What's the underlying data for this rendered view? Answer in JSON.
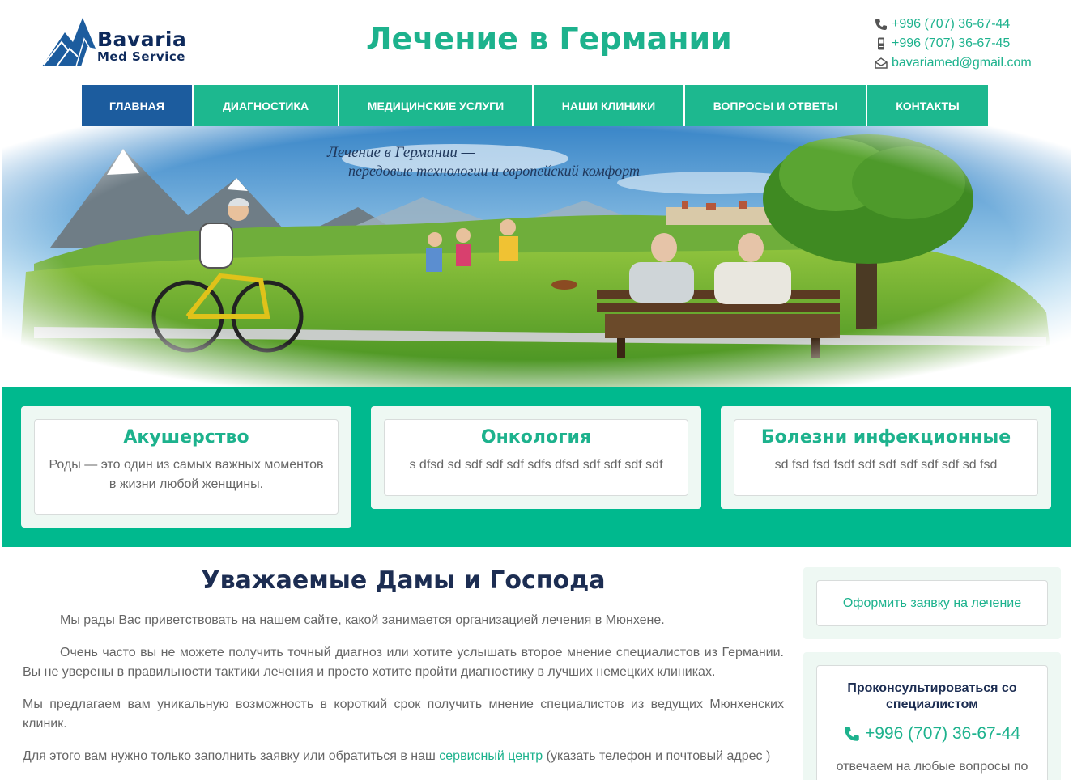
{
  "header": {
    "logo_name": "Bavaria",
    "logo_sub": "Med Service",
    "site_title": "Лечение в Германии",
    "phone1": "+996 (707) 36-67-44",
    "phone2": "+996 (707) 36-67-45",
    "email": "bavariamed@gmail.com"
  },
  "nav": {
    "items": [
      {
        "label": "ГЛАВНАЯ"
      },
      {
        "label": "ДИАГНОСТИКА"
      },
      {
        "label": "МЕДИЦИНСКИЕ УСЛУГИ"
      },
      {
        "label": "НАШИ КЛИНИКИ"
      },
      {
        "label": "ВОПРОСЫ И ОТВЕТЫ"
      },
      {
        "label": "КОНТАКТЫ"
      }
    ]
  },
  "hero": {
    "tagline_line1": "Лечение в Германии —",
    "tagline_line2": "передовые технологии и европейский комфорт"
  },
  "cards": [
    {
      "title": "Акушерство",
      "text": "Роды — это один из самых важных моментов в жизни любой женщины."
    },
    {
      "title": "Онкология",
      "text": "s dfsd sd sdf sdf sdf sdfs dfsd sdf sdf sdf sdf"
    },
    {
      "title": "Болезни инфекционные",
      "text": "sd fsd fsd fsdf sdf sdf sdf sdf sdf sd fsd"
    }
  ],
  "main": {
    "title": "Уважаемые Дамы и Господа",
    "p1": "Мы рады Вас приветствовать на нашем сайте, какой занимается организацией лечения в Мюнхене.",
    "p2": "Очень часто вы не можете получить точный диагноз или хотите услышать второе мнение специалистов из Германии. Вы не уверены в правильности тактики лечения и просто хотите пройти диагностику в лучших немецких клиниках.",
    "p3": "Мы предлагаем вам уникальную возможность в короткий срок получить мнение специалистов из ведущих Мюнхенских клиник.",
    "p4_before": "Для этого вам нужно только заполнить заявку или обратиться в наш ",
    "p4_link": "сервисный центр",
    "p4_after": " (указать телефон и почтовый адрес )"
  },
  "sidebar": {
    "apply_label": "Оформить заявку на лечение",
    "consult_title": "Проконсультироваться со специалистом",
    "consult_phone": "+996 (707) 36-67-44",
    "consult_note": "отвечаем на любые вопросы по"
  },
  "colors": {
    "accent": "#1db28d",
    "nav_active": "#1c5c9e",
    "band": "#00b98e",
    "heading": "#1c2d52"
  }
}
